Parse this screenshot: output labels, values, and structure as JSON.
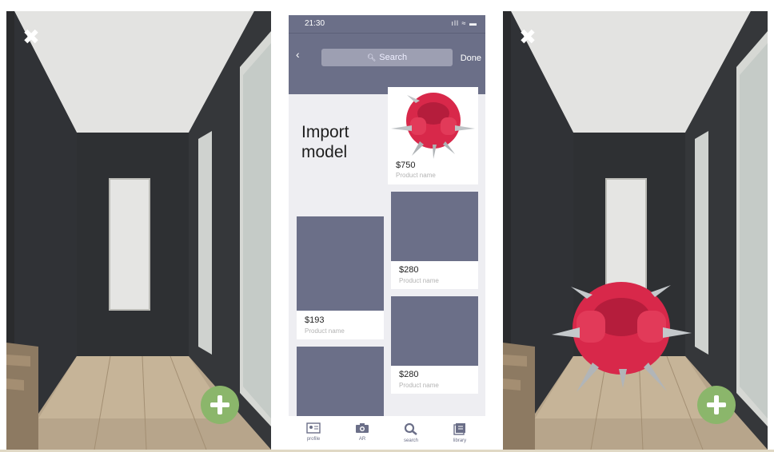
{
  "left_view": {
    "close_icon": "close-icon",
    "add_icon": "plus-icon"
  },
  "phone": {
    "status": {
      "time": "21:30",
      "icons": "ıll ≈ ▬"
    },
    "navbar": {
      "back": "‹",
      "search_placeholder": "Search",
      "done": "Done"
    },
    "import_label": "Import model",
    "products": [
      {
        "price": "$750",
        "name": "Product name"
      },
      {
        "price": "$280",
        "name": "Product name"
      },
      {
        "price": "$193",
        "name": "Product name"
      },
      {
        "price": "$280",
        "name": "Product name"
      }
    ],
    "tabs": [
      {
        "label": "profile",
        "icon": "profile-icon"
      },
      {
        "label": "AR",
        "icon": "camera-icon"
      },
      {
        "label": "search",
        "icon": "search-icon"
      },
      {
        "label": "library",
        "icon": "library-icon"
      }
    ]
  },
  "right_view": {
    "close_icon": "close-icon",
    "add_icon": "plus-icon"
  },
  "colors": {
    "accent_green": "#8bb66b",
    "placeholder_slate": "#6b6f88",
    "chair_red": "#d8284a"
  }
}
